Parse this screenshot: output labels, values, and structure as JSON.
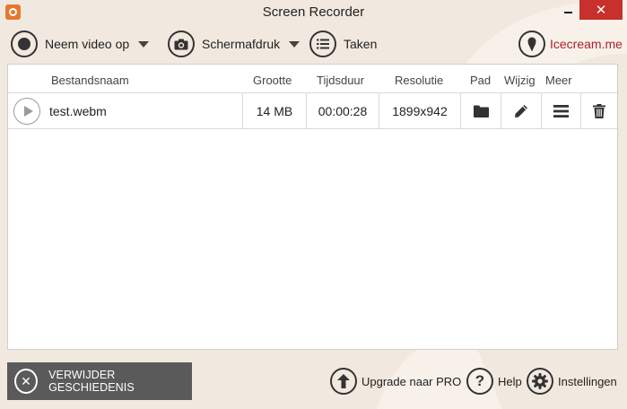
{
  "window": {
    "title": "Screen Recorder",
    "close_glyph": "✕"
  },
  "toolbar": {
    "record_label": "Neem video op",
    "screenshot_label": "Schermafdruk",
    "tasks_label": "Taken",
    "brand_label": "Icecream.me"
  },
  "table": {
    "headers": {
      "filename": "Bestandsnaam",
      "size": "Grootte",
      "duration": "Tijdsduur",
      "resolution": "Resolutie",
      "path": "Pad",
      "edit": "Wijzig",
      "more": "Meer"
    },
    "rows": [
      {
        "filename": "test.webm",
        "size": "14 MB",
        "duration": "00:00:28",
        "resolution": "1899x942"
      }
    ]
  },
  "bottom": {
    "clear_history_label": "VERWIJDER GESCHIEDENIS",
    "clear_glyph": "✕",
    "upgrade_label": "Upgrade naar PRO",
    "help_label": "Help",
    "help_glyph": "?",
    "settings_label": "Instellingen"
  },
  "colors": {
    "background": "#f1e9df",
    "close_button": "#c7302b",
    "brand": "#b11f2a",
    "clear_button": "#5a5a5a",
    "app_icon": "#e8772e"
  }
}
